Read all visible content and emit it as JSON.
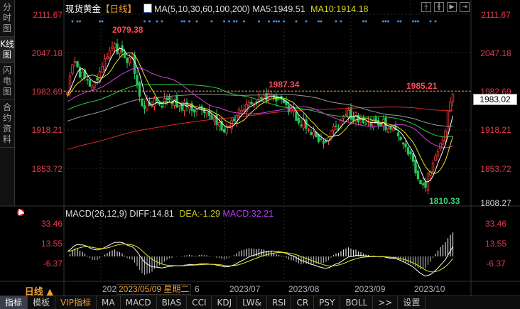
{
  "side_tabs": [
    {
      "label": "分时图"
    },
    {
      "label": "K线图"
    },
    {
      "label": "闪电图"
    },
    {
      "label": "合约资料"
    }
  ],
  "header": {
    "title": "现货黄金",
    "period": "【日线】",
    "ma_label": "MA(5,10,30,60,100,200)",
    "ma5": "MA5:1949.51",
    "ma10": "MA10:1914.18"
  },
  "toolbar_icons": [
    "crosshair-icon",
    "range-icon",
    "play-icon",
    "next-icon"
  ],
  "price_axis": {
    "left": [
      "2111.67",
      "2047.18",
      "1982.69",
      "1918.21",
      "1853.72"
    ],
    "right": [
      "2111.67",
      "2047.18",
      "1982.69",
      "1918.21",
      "1853.72",
      "1808.27"
    ],
    "current": "1983.02"
  },
  "annotations": {
    "high1": "2079.38",
    "high2": "1987.34",
    "high3": "1985.21",
    "low": "1810.33"
  },
  "macd": {
    "label": "MACD(26,12,9)",
    "diff": "DIFF:14.81",
    "dea": "DEA:-1.29",
    "macd": "MACD:32.21",
    "axis": [
      "33.46",
      "13.55",
      "-6.37"
    ]
  },
  "period_button": "日线 ▲",
  "dates": {
    "first": "202",
    "cursor": "2023/05/09 星期二",
    "after": "6",
    "d1": "2023/07",
    "d2": "2023/08",
    "d3": "2023/09",
    "d4": "2023/10"
  },
  "bottom_tabs": [
    "指标",
    "模板",
    "VIP指标",
    "MA",
    "MACD",
    "BIAS",
    "CCI",
    "KDJ",
    "LW&",
    "RSI",
    "CR",
    "PSY",
    "BOLL",
    ">>",
    "设置"
  ],
  "colors": {
    "up": "#ff3c3c",
    "down": "#23c45a",
    "ma5": "#ffffff",
    "ma10": "#e6e61e",
    "ma30": "#d040e0",
    "ma60": "#2ecc40",
    "ma100": "#999999",
    "ma200": "#e02828"
  },
  "price_waypoints": [
    [
      0,
      1985
    ],
    [
      2,
      2030
    ],
    [
      10,
      1985
    ],
    [
      17,
      2060
    ],
    [
      26,
      2030
    ],
    [
      30,
      1960
    ],
    [
      42,
      1965
    ],
    [
      53,
      1950
    ],
    [
      63,
      1920
    ],
    [
      72,
      1955
    ],
    [
      79,
      1975
    ],
    [
      87,
      1960
    ],
    [
      96,
      1925
    ],
    [
      103,
      1900
    ],
    [
      113,
      1945
    ],
    [
      122,
      1930
    ],
    [
      130,
      1925
    ],
    [
      137,
      1880
    ],
    [
      143,
      1820
    ],
    [
      147,
      1860
    ],
    [
      152,
      1920
    ],
    [
      155,
      1980
    ]
  ]
}
